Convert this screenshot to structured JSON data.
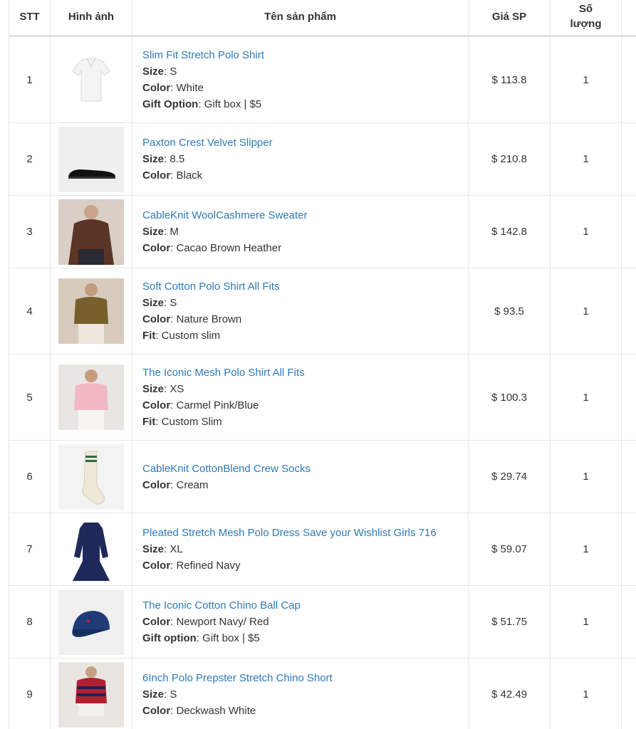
{
  "columns": {
    "stt": "STT",
    "image": "Hình ảnh",
    "name": "Tên sản phẩm",
    "price": "Giá SP",
    "qty_line1": "Số",
    "qty_line2": "lượng"
  },
  "products": [
    {
      "stt": "1",
      "name": "Slim Fit Stretch Polo Shirt",
      "attrs": [
        {
          "label": "Size",
          "value": ": S"
        },
        {
          "label": "Color",
          "value": ": White"
        },
        {
          "label": "Gift Option",
          "value": ": Gift box | $5"
        }
      ],
      "price": "$ 113.8",
      "qty": "1",
      "image_icon": "white-polo-shirt-image"
    },
    {
      "stt": "2",
      "name": "Paxton Crest Velvet Slipper",
      "attrs": [
        {
          "label": "Size",
          "value": ": 8.5"
        },
        {
          "label": "Color",
          "value": ": Black"
        }
      ],
      "price": "$ 210.8",
      "qty": "1",
      "image_icon": "black-slipper-image"
    },
    {
      "stt": "3",
      "name": "CableKnit WoolCashmere Sweater",
      "attrs": [
        {
          "label": "Size",
          "value": ": M"
        },
        {
          "label": "Color",
          "value": ": Cacao Brown Heather"
        }
      ],
      "price": "$ 142.8",
      "qty": "1",
      "image_icon": "brown-sweater-image"
    },
    {
      "stt": "4",
      "name": "Soft Cotton Polo Shirt All Fits",
      "attrs": [
        {
          "label": "Size",
          "value": ": S"
        },
        {
          "label": "Color",
          "value": ": Nature Brown"
        },
        {
          "label": "Fit",
          "value": ": Custom slim"
        }
      ],
      "price": "$ 93.5",
      "qty": "1",
      "image_icon": "brown-polo-image"
    },
    {
      "stt": "5",
      "name": "The Iconic Mesh Polo Shirt All Fits",
      "attrs": [
        {
          "label": "Size",
          "value": ": XS"
        },
        {
          "label": "Color",
          "value": ": Carmel Pink/Blue"
        },
        {
          "label": "Fit",
          "value": ": Custom Slim"
        }
      ],
      "price": "$ 100.3",
      "qty": "1",
      "image_icon": "pink-polo-image"
    },
    {
      "stt": "6",
      "name": "CableKnit CottonBlend Crew Socks",
      "attrs": [
        {
          "label": "Color",
          "value": ": Cream"
        }
      ],
      "price": "$ 29.74",
      "qty": "1",
      "image_icon": "cream-socks-image"
    },
    {
      "stt": "7",
      "name": "Pleated Stretch Mesh Polo Dress Save your Wishlist Girls 716",
      "attrs": [
        {
          "label": "Size",
          "value": ": XL"
        },
        {
          "label": "Color",
          "value": ": Refined Navy"
        }
      ],
      "price": "$ 59.07",
      "qty": "1",
      "image_icon": "navy-dress-image"
    },
    {
      "stt": "8",
      "name": "The Iconic Cotton Chino Ball Cap",
      "attrs": [
        {
          "label": "Color",
          "value": ": Newport Navy/ Red"
        },
        {
          "label": "Gift option",
          "value": ": Gift box | $5"
        }
      ],
      "price": "$ 51.75",
      "qty": "1",
      "image_icon": "navy-cap-image"
    },
    {
      "stt": "9",
      "name": "6Inch Polo Prepster Stretch Chino Short",
      "attrs": [
        {
          "label": "Size",
          "value": ": S"
        },
        {
          "label": "Color",
          "value": ": Deckwash White"
        }
      ],
      "price": "$ 42.49",
      "qty": "1",
      "image_icon": "chino-short-image"
    }
  ],
  "colors": {
    "link": "#2f7ab8",
    "text": "#333333",
    "border": "#e6e6e6"
  }
}
